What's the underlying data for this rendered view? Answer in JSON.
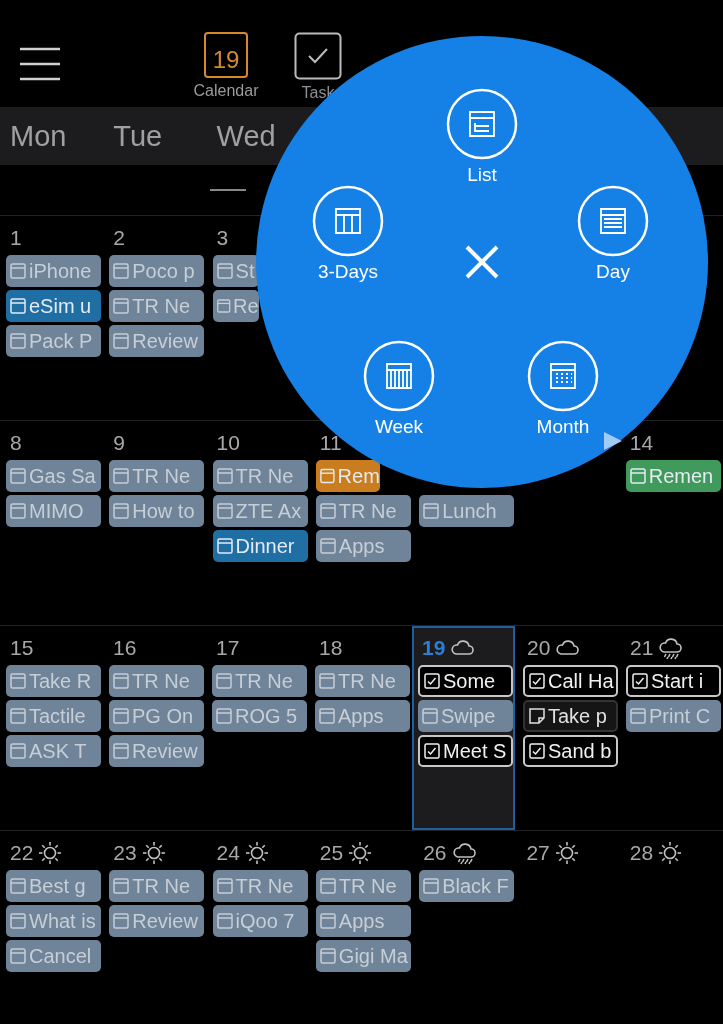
{
  "top_bar": {
    "tabs": [
      {
        "kind": "calendar",
        "label": "Calendar",
        "icon_text": "19",
        "selected": true
      },
      {
        "kind": "tasks",
        "label": "Task",
        "selected": false
      }
    ]
  },
  "weekdays": [
    "Mon",
    "Tue",
    "Wed"
  ],
  "weeks": [
    {
      "days": [
        {
          "date": "1",
          "items": [
            {
              "kind": "event",
              "text": "iPhone",
              "color": "#6f8399"
            },
            {
              "kind": "event",
              "text": "eSim u",
              "color": "#1f6fa5"
            },
            {
              "kind": "event",
              "text": "Pack P",
              "color": "#6f8399"
            }
          ]
        },
        {
          "date": "2",
          "items": [
            {
              "kind": "event",
              "text": "Poco p",
              "color": "#6f8399"
            },
            {
              "kind": "event",
              "text": "TR Ne",
              "color": "#6f8399"
            },
            {
              "kind": "event",
              "text": "Review",
              "color": "#6f8399"
            }
          ]
        },
        {
          "date": "3",
          "items": [
            {
              "kind": "event",
              "text": "St",
              "color": "#6f8399"
            },
            {
              "kind": "event",
              "text": "Re",
              "color": "#6f8399"
            }
          ]
        }
      ]
    },
    {
      "days": [
        {
          "date": "8",
          "items": [
            {
              "kind": "event",
              "text": "Gas Sa",
              "color": "#6f8399"
            },
            {
              "kind": "event",
              "text": "MIMO",
              "color": "#6f8399"
            }
          ]
        },
        {
          "date": "9",
          "items": [
            {
              "kind": "event",
              "text": "TR Ne",
              "color": "#6f8399"
            },
            {
              "kind": "event",
              "text": "How to",
              "color": "#6f8399"
            }
          ]
        },
        {
          "date": "10",
          "items": [
            {
              "kind": "event",
              "text": "TR Ne",
              "color": "#6f8399"
            },
            {
              "kind": "event",
              "text": "ZTE Ax",
              "color": "#6f8399"
            },
            {
              "kind": "event",
              "text": "Dinner",
              "color": "#1f6fa5"
            }
          ]
        },
        {
          "date": "11",
          "items": [
            {
              "kind": "event",
              "text": "Rem",
              "color": "#c97d1e"
            },
            {
              "kind": "event",
              "text": "TR Ne",
              "color": "#6f8399"
            },
            {
              "kind": "event",
              "text": "Apps",
              "color": "#6f8399"
            }
          ]
        },
        {
          "items": [
            {
              "kind": "covered"
            },
            {
              "kind": "event",
              "text": "Lunch",
              "color": "#6f8399"
            }
          ]
        },
        {
          "items": [
            {
              "kind": "covered"
            }
          ]
        },
        {
          "date": "14",
          "items": [
            {
              "kind": "event",
              "text": "Remen",
              "color": "#3f9a5c"
            }
          ]
        }
      ]
    },
    {
      "days": [
        {
          "date": "15",
          "items": [
            {
              "kind": "event",
              "text": "Take R",
              "color": "#6f8399"
            },
            {
              "kind": "event",
              "text": "Tactile",
              "color": "#6f8399"
            },
            {
              "kind": "event",
              "text": "ASK T",
              "color": "#6f8399"
            }
          ]
        },
        {
          "date": "16",
          "items": [
            {
              "kind": "event",
              "text": "TR Ne",
              "color": "#6f8399"
            },
            {
              "kind": "event",
              "text": "PG On",
              "color": "#6f8399"
            },
            {
              "kind": "event",
              "text": "Review",
              "color": "#6f8399"
            }
          ]
        },
        {
          "date": "17",
          "items": [
            {
              "kind": "event",
              "text": "TR Ne",
              "color": "#6f8399"
            },
            {
              "kind": "event",
              "text": "ROG 5",
              "color": "#6f8399"
            }
          ]
        },
        {
          "date": "18",
          "items": [
            {
              "kind": "event",
              "text": "TR Ne",
              "color": "#6f8399"
            },
            {
              "kind": "event",
              "text": "Apps",
              "color": "#6f8399"
            }
          ]
        },
        {
          "date": "19",
          "weather": {
            "kind": "cloud"
          },
          "selected": true,
          "items": [
            {
              "kind": "task",
              "text": "Some"
            },
            {
              "kind": "event",
              "text": "Swipe",
              "color": "#6f8399"
            },
            {
              "kind": "task",
              "text": "Meet S"
            }
          ]
        },
        {
          "date": "20",
          "weather": {
            "kind": "cloud"
          },
          "selected": false,
          "items": [
            {
              "kind": "task",
              "text": "Call Ha"
            },
            {
              "kind": "note",
              "text": "Take p"
            },
            {
              "kind": "task",
              "text": "Sand b"
            }
          ]
        },
        {
          "date": "21",
          "weather": {
            "kind": "rain"
          },
          "selected": false,
          "items": [
            {
              "kind": "task",
              "text": "Start i"
            },
            {
              "kind": "event",
              "text": "Print C",
              "color": "#6f8399"
            }
          ]
        }
      ]
    },
    {
      "days": [
        {
          "date": "22",
          "weather": {
            "kind": "sun"
          },
          "items": [
            {
              "kind": "event",
              "text": "Best g",
              "color": "#6f8399"
            },
            {
              "kind": "event",
              "text": "What is",
              "color": "#6f8399"
            },
            {
              "kind": "event",
              "text": "Cancel",
              "color": "#6f8399"
            }
          ]
        },
        {
          "date": "23",
          "weather": {
            "kind": "sun"
          },
          "items": [
            {
              "kind": "event",
              "text": "TR Ne",
              "color": "#6f8399"
            },
            {
              "kind": "event",
              "text": "Review",
              "color": "#6f8399"
            }
          ]
        },
        {
          "date": "24",
          "weather": {
            "kind": "sun"
          },
          "items": [
            {
              "kind": "event",
              "text": "TR Ne",
              "color": "#6f8399"
            },
            {
              "kind": "event",
              "text": "iQoo 7",
              "color": "#6f8399"
            }
          ]
        },
        {
          "date": "25",
          "weather": {
            "kind": "sun"
          },
          "items": [
            {
              "kind": "event",
              "text": "TR Ne",
              "color": "#6f8399"
            },
            {
              "kind": "event",
              "text": "Apps",
              "color": "#6f8399"
            },
            {
              "kind": "event",
              "text": "Gigi Ma",
              "color": "#6f8399"
            }
          ]
        },
        {
          "date": "26",
          "weather": {
            "kind": "rain"
          },
          "items": [
            {
              "kind": "event",
              "text": "Black F",
              "color": "#6f8399"
            }
          ]
        },
        {
          "date": "27",
          "weather": {
            "kind": "sun"
          }
        },
        {
          "date": "28",
          "weather": {
            "kind": "sun"
          }
        }
      ]
    }
  ],
  "view_menu": {
    "options": [
      {
        "kind": "list",
        "label": "List"
      },
      {
        "kind": "three_days",
        "label": "3-Days"
      },
      {
        "kind": "day",
        "label": "Day"
      },
      {
        "kind": "week",
        "label": "Week"
      },
      {
        "kind": "month",
        "label": "Month"
      }
    ]
  }
}
